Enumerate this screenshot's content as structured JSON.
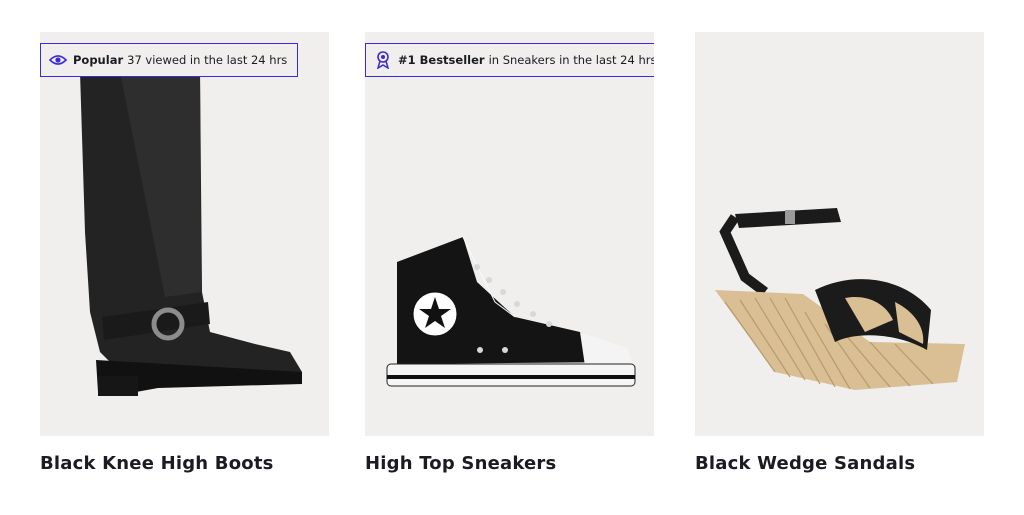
{
  "products": [
    {
      "badge": {
        "icon": "eye-icon",
        "strong": "Popular",
        "text": "37 viewed in the last 24 hrs"
      },
      "title": "Black Knee High Boots"
    },
    {
      "badge": {
        "icon": "ribbon-award-icon",
        "strong": "#1 Bestseller",
        "text": "in Sneakers in the last 24 hrs"
      },
      "title": "High Top Sneakers"
    },
    {
      "badge": null,
      "title": "Black Wedge Sandals"
    }
  ],
  "colors": {
    "badge_border": "#3a2bd6",
    "card_bg": "#f0efee",
    "text": "#1b1b22"
  }
}
